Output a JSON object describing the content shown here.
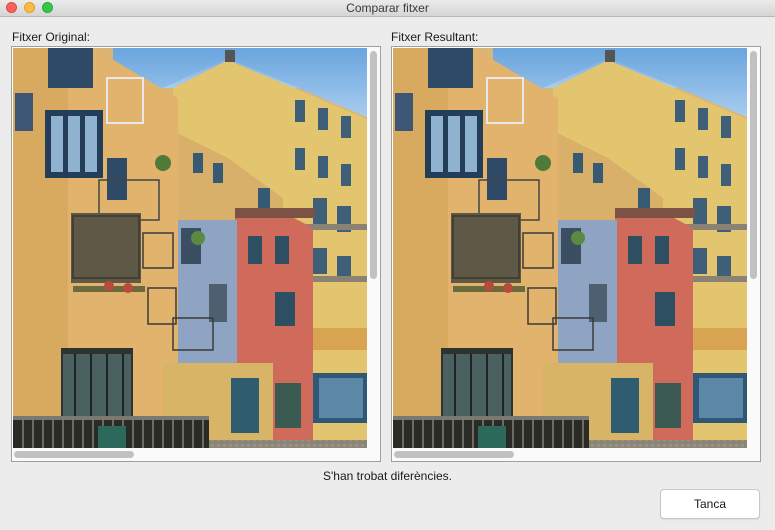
{
  "window": {
    "title": "Comparar fitxer"
  },
  "panels": [
    {
      "label": "Fitxer Original:",
      "image": "colorful-riverside-buildings-photo"
    },
    {
      "label": "Fitxer Resultant:",
      "image": "colorful-riverside-buildings-photo"
    }
  ],
  "status": "S'han trobat diferències.",
  "close_button": "Tanca"
}
